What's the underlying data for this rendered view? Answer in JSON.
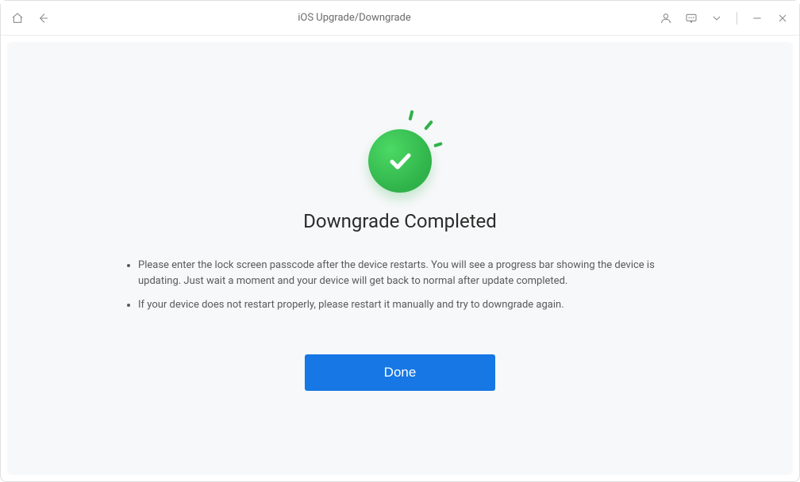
{
  "window": {
    "title": "iOS Upgrade/Downgrade"
  },
  "main": {
    "heading": "Downgrade Completed",
    "bullets": [
      "Please enter the lock screen passcode after the device restarts. You will see a progress bar showing the device is updating. Just wait a moment and your device will get back to normal after update completed.",
      "If your device does not restart properly, please restart it manually and try to downgrade again."
    ],
    "done_label": "Done"
  }
}
